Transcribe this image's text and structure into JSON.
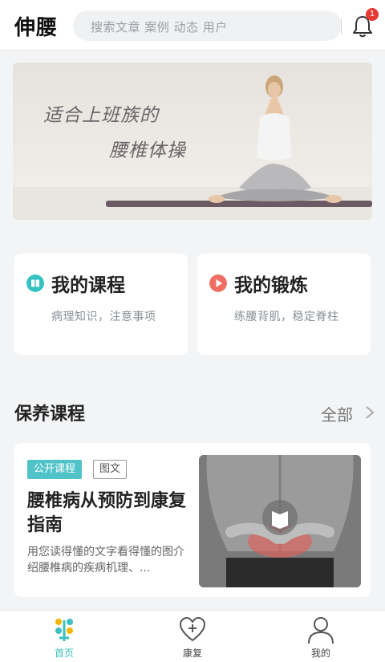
{
  "header": {
    "app_title": "伸腰",
    "search_placeholder": "搜索文章 案例 动态 用户",
    "notification_count": "1"
  },
  "banner": {
    "line1": "适合上班族的",
    "line2": "腰椎体操"
  },
  "quick_cards": [
    {
      "title": "我的课程",
      "subtitle": "病理知识，注意事项",
      "icon": "course-icon",
      "color": "#33c2c0"
    },
    {
      "title": "我的锻炼",
      "subtitle": "练腰背肌，稳定脊柱",
      "icon": "play-icon",
      "color": "#f06e63"
    }
  ],
  "section": {
    "title": "保养课程",
    "more_label": "全部"
  },
  "course": {
    "tag_public": "公开课程",
    "tag_type": "图文",
    "title": "腰椎病从预防到康复指南",
    "description": "用您读得懂的文字看得懂的图介绍腰椎病的疾病机理、..."
  },
  "tabbar": {
    "items": [
      {
        "label": "首页",
        "icon": "home-icon",
        "active": true
      },
      {
        "label": "康复",
        "icon": "heart-plus-icon",
        "active": false
      },
      {
        "label": "我的",
        "icon": "user-icon",
        "active": false
      }
    ]
  },
  "colors": {
    "accent": "#3cbfbf",
    "badge": "#e53935"
  }
}
